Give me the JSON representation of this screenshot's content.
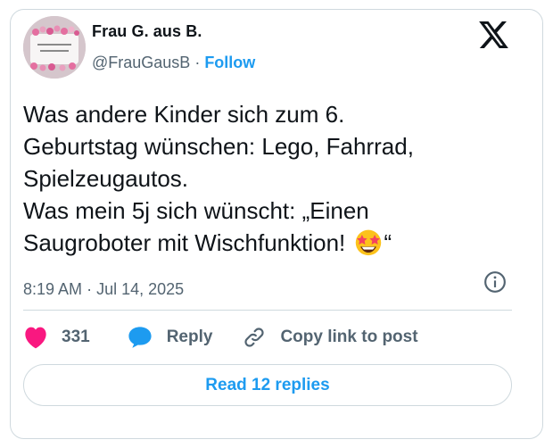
{
  "author": {
    "display_name": "Frau G. aus B.",
    "handle": "@FrauGausB",
    "separator": "·",
    "follow_label": "Follow",
    "avatar_text": "ICH BIN NUR ZUM STAUBEN HIER"
  },
  "tweet": {
    "text": "Was andere Kinder sich zum 6.\nGeburtstag wünschen: Lego, Fahrrad,\nSpielzeugautos.\nWas mein 5j sich wünscht: „Einen\nSaugroboter mit Wischfunktion! ",
    "closing_quote": "“",
    "emoji": "star-struck-emoji"
  },
  "meta": {
    "time": "8:19 AM",
    "separator": "·",
    "date": "Jul 14, 2025"
  },
  "actions": {
    "like_count": "331",
    "reply_label": "Reply",
    "copy_label": "Copy link to post"
  },
  "replies_button": "Read 12 replies",
  "colors": {
    "accent": "#1d9bf0",
    "like": "#f91880",
    "text": "#0f1419",
    "secondary": "#536471",
    "border": "#cfd9de"
  }
}
